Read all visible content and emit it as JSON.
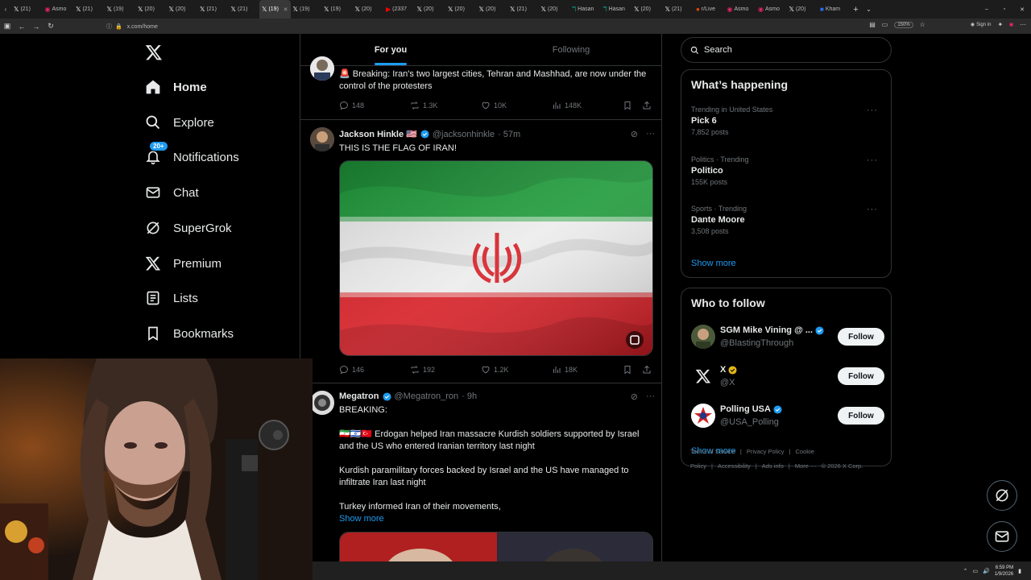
{
  "browser": {
    "tabs": [
      {
        "label": "(21) ",
        "icon": "X"
      },
      {
        "label": "Asmo",
        "icon": "asmon"
      },
      {
        "label": "(21) ",
        "icon": "X"
      },
      {
        "label": "(19) ",
        "icon": "X"
      },
      {
        "label": "(20) ",
        "icon": "X"
      },
      {
        "label": "(20) ",
        "icon": "X"
      },
      {
        "label": "(21) ",
        "icon": "X"
      },
      {
        "label": "(21) ",
        "icon": "X"
      },
      {
        "label": "(19) ",
        "icon": "X"
      },
      {
        "label": "(19) ",
        "icon": "X"
      },
      {
        "label": "(19) ",
        "icon": "X"
      },
      {
        "label": "(20) ",
        "icon": "X"
      },
      {
        "label": "(2337",
        "icon": "youtube"
      },
      {
        "label": "(20) ",
        "icon": "X"
      },
      {
        "label": "(20) ",
        "icon": "X"
      },
      {
        "label": "(20) ",
        "icon": "X"
      },
      {
        "label": "(21) ",
        "icon": "X"
      },
      {
        "label": "(20) ",
        "icon": "X"
      },
      {
        "label": "Hasan",
        "icon": "twitch"
      },
      {
        "label": "Hasan",
        "icon": "twitch"
      },
      {
        "label": "(20) ",
        "icon": "X"
      },
      {
        "label": "(21) ",
        "icon": "X"
      },
      {
        "label": "r/Live",
        "icon": "reddit"
      },
      {
        "label": "Asmo",
        "icon": "asmon"
      },
      {
        "label": "Asmo",
        "icon": "asmon"
      },
      {
        "label": "(20) ",
        "icon": "X"
      },
      {
        "label": "Kham",
        "icon": "blue"
      }
    ],
    "active_tab": 8,
    "url": "x.com/home",
    "zoom": "150%",
    "sign_in": "Sign in"
  },
  "nav": {
    "items": [
      {
        "label": "Home",
        "icon": "home-icon"
      },
      {
        "label": "Explore",
        "icon": "search-icon"
      },
      {
        "label": "Notifications",
        "icon": "bell-icon",
        "badge": "20+"
      },
      {
        "label": "Chat",
        "icon": "mail-icon"
      },
      {
        "label": "SuperGrok",
        "icon": "grok-icon"
      },
      {
        "label": "Premium",
        "icon": "x-icon"
      },
      {
        "label": "Lists",
        "icon": "list-icon"
      },
      {
        "label": "Bookmarks",
        "icon": "bookmark-icon"
      }
    ]
  },
  "feed": {
    "tabs": [
      "For you",
      "Following"
    ],
    "posts": [
      {
        "text": "🚨 Breaking: Iran's two largest cities, Tehran and Mashhad, are now under the control of the protesters",
        "replies": "148",
        "reposts": "1.3K",
        "likes": "10K",
        "views": "148K"
      },
      {
        "name": "Jackson Hinkle 🇺🇸",
        "handle": "@jacksonhinkle",
        "time": "· 57m",
        "text": "THIS IS THE FLAG OF IRAN!",
        "replies": "146",
        "reposts": "192",
        "likes": "1.2K",
        "views": "18K"
      },
      {
        "name": "Megatron",
        "handle": "@Megatron_ron",
        "time": "· 9h",
        "lines": [
          "BREAKING:",
          "🇮🇷🇮🇱🇹🇷 Erdogan helped Iran massacre Kurdish soldiers supported by Israel and the US who entered Iranian territory last night",
          "Kurdish paramilitary forces backed by Israel and the US have managed to infiltrate Iran last night",
          "Turkey informed Iran of their movements,"
        ],
        "show_more": "Show more"
      }
    ]
  },
  "sidebar": {
    "search_placeholder": "Search",
    "happening_title": "What’s happening",
    "trends": [
      {
        "category": "Trending in United States",
        "name": "Pick 6",
        "count": "7,852 posts"
      },
      {
        "category": "Politics · Trending",
        "name": "Politico",
        "count": "155K posts"
      },
      {
        "category": "Sports · Trending",
        "name": "Dante Moore",
        "count": "3,508 posts"
      }
    ],
    "show_more": "Show more",
    "follow_title": "Who to follow",
    "follow": [
      {
        "name": "SGM Mike Vining @ ...",
        "handle": "@BlastingThrough",
        "button": "Follow"
      },
      {
        "name": "X",
        "handle": "@X",
        "button": "Follow"
      },
      {
        "name": "Polling USA",
        "handle": "@USA_Polling",
        "button": "Follow"
      }
    ],
    "follow_show_more": "Show more",
    "footer_links": [
      "Terms of Service",
      "|",
      "Privacy Policy",
      "|",
      "Cookie Policy",
      "|",
      "Accessibility",
      "|",
      "Ads info",
      "|",
      "More ···",
      "© 2026 X Corp."
    ]
  },
  "taskbar": {
    "time": "6:59 PM",
    "date": "1/9/2026"
  },
  "colors": {
    "accent": "#1d9bf0",
    "background": "#000000",
    "border": "#2f3336",
    "muted": "#71767b"
  }
}
